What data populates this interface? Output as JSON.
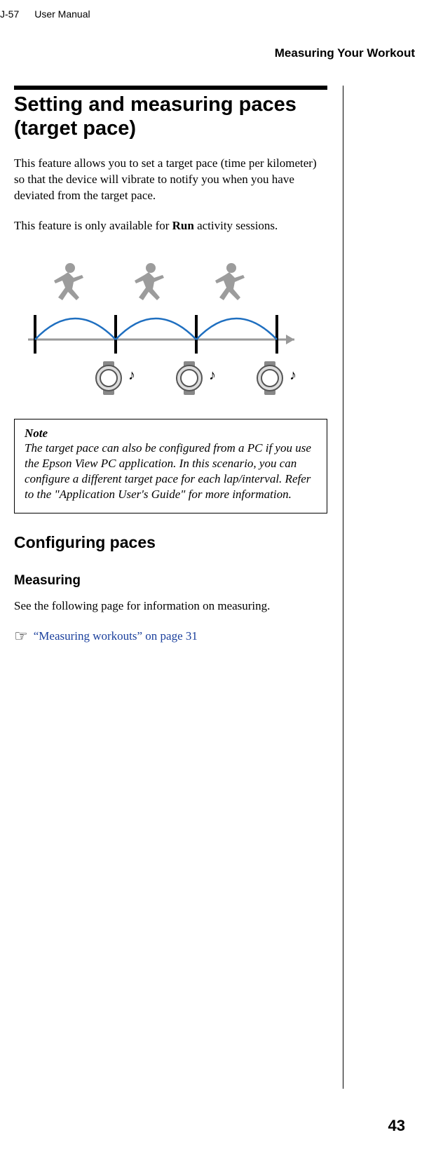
{
  "header": {
    "model": "J-57",
    "doc_title": "User Manual",
    "category": "Measuring Your Workout"
  },
  "section": {
    "title": "Setting and measuring paces (target pace)",
    "p1_a": "This feature allows you to set a target pace (time per kilometer) so that the device will vibrate to notify you when you have deviated from the target pace.",
    "p2_a": "This feature is only available for ",
    "p2_bold": "Run",
    "p2_b": " activity sessions."
  },
  "note": {
    "label": "Note",
    "body": "The target pace can also be configured from a PC if you use the Epson View PC application. In this scenario, you can configure a different target pace for each lap/interval. Refer to the \"Application User's Guide\" for more information."
  },
  "sub1": "Configuring paces",
  "sub2": "Measuring",
  "measuring_p": "See the following page for information on measuring.",
  "xref": {
    "icon": "hand-icon",
    "text": "“Measuring workouts” on page 31"
  },
  "page_number": "43"
}
